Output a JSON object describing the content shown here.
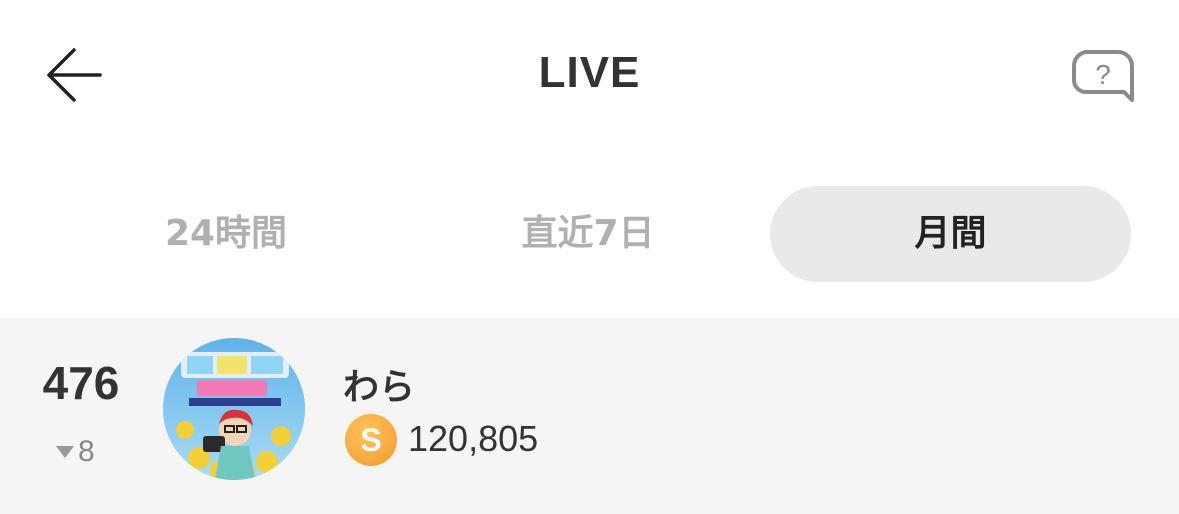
{
  "header": {
    "title": "LIVE",
    "back_icon": "arrow-left-icon",
    "help_icon": "question-bubble-icon"
  },
  "tabs": [
    {
      "label": "24時間",
      "active": false
    },
    {
      "label": "直近7日",
      "active": false
    },
    {
      "label": "月間",
      "active": true
    }
  ],
  "ranking": [
    {
      "rank": "476",
      "change_direction": "down",
      "change": "8",
      "name": "わら",
      "coin_symbol": "S",
      "points": "120,805"
    }
  ],
  "colors": {
    "active_tab_bg": "#e9e9e9",
    "inactive_tab_text": "#b0b0b0",
    "row_bg": "#f5f5f5",
    "coin": "#f4a53a"
  }
}
